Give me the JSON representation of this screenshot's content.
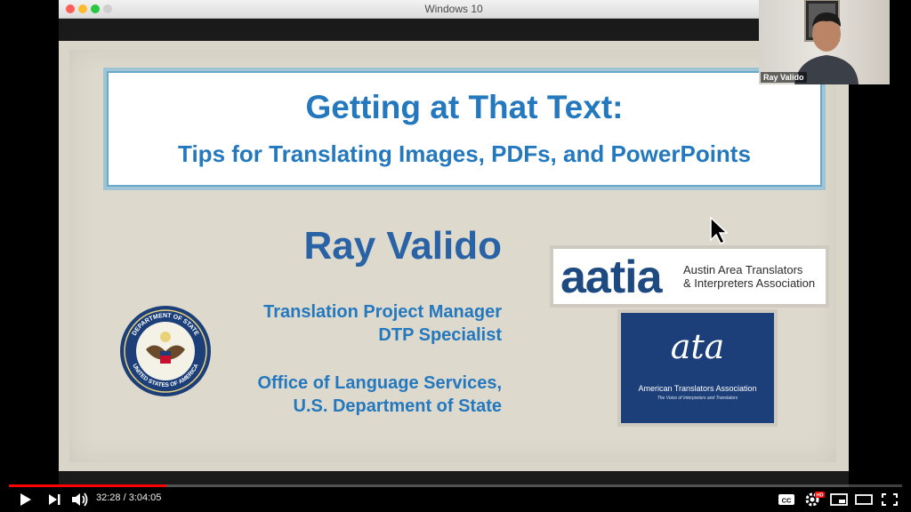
{
  "window": {
    "title": "Windows 10"
  },
  "slide": {
    "title_line1": "Getting at That Text:",
    "title_line2": "Tips for Translating Images, PDFs, and PowerPoints",
    "presenter": "Ray Valido",
    "role_line1": "Translation Project Manager",
    "role_line2": "DTP Specialist",
    "org_line1": "Office of Language Services,",
    "org_line2": "U.S. Department of State",
    "seal": {
      "top_text": "DEPARTMENT OF STATE",
      "bottom_text": "UNITED STATES OF AMERICA"
    },
    "aatia": {
      "logo": "aatia",
      "line1": "Austin Area Translators",
      "line2": "& Interpreters Association"
    },
    "ata": {
      "logo": "ata",
      "name": "American Translators Association",
      "tagline": "The Voice of Interpreters and Translators"
    }
  },
  "webcam": {
    "name": "Ray Valido"
  },
  "player": {
    "current_time": "32:28",
    "separator": " / ",
    "duration": "3:04:05",
    "progress_fraction": 0.176,
    "hd_badge": "HD",
    "accent_color": "#ff0000"
  },
  "icons": {
    "play": "play-icon",
    "next": "next-icon",
    "volume": "volume-icon",
    "captions": "captions-icon",
    "settings": "gear-icon",
    "miniplayer": "miniplayer-icon",
    "theater": "theater-icon",
    "fullscreen": "fullscreen-icon"
  }
}
